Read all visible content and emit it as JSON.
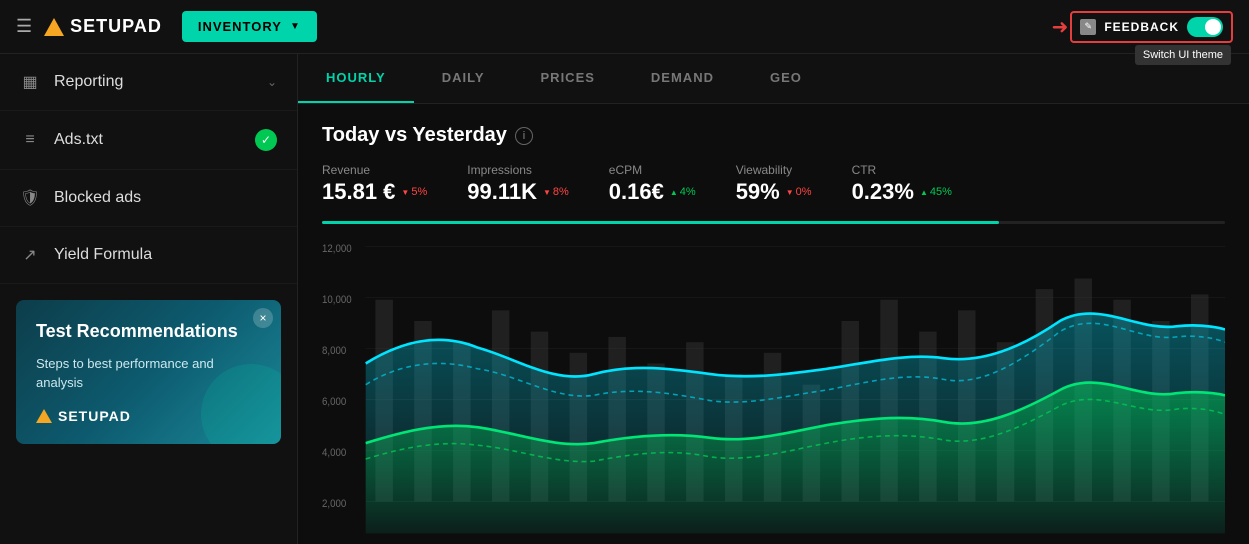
{
  "header": {
    "menu_label": "☰",
    "logo_text": "SETUPAD",
    "inventory_label": "INVENTORY",
    "feedback_label": "FEEDBACK",
    "switch_ui_tooltip": "Switch UI theme"
  },
  "sidebar": {
    "items": [
      {
        "id": "reporting",
        "label": "Reporting",
        "icon": "bar-chart",
        "has_chevron": true
      },
      {
        "id": "ads-txt",
        "label": "Ads.txt",
        "icon": "list",
        "has_check": true
      },
      {
        "id": "blocked-ads",
        "label": "Blocked ads",
        "icon": "shield",
        "has_nothing": true
      },
      {
        "id": "yield-formula",
        "label": "Yield Formula",
        "icon": "trending-up",
        "has_nothing": true
      }
    ],
    "promo": {
      "title": "Test Recommendations",
      "subtitle": "Steps to best performance and analysis",
      "logo_text": "SETUPAD",
      "close_label": "×"
    }
  },
  "tabs": [
    {
      "id": "hourly",
      "label": "HOURLY",
      "active": true
    },
    {
      "id": "daily",
      "label": "DAILY",
      "active": false
    },
    {
      "id": "prices",
      "label": "PRICES",
      "active": false
    },
    {
      "id": "demand",
      "label": "DEMAND",
      "active": false
    },
    {
      "id": "geo",
      "label": "GEO",
      "active": false
    }
  ],
  "chart": {
    "title": "Today vs Yesterday",
    "metrics": [
      {
        "label": "Revenue",
        "value": "15.81 €",
        "change": "5%",
        "direction": "down"
      },
      {
        "label": "Impressions",
        "value": "99.11K",
        "change": "8%",
        "direction": "down"
      },
      {
        "label": "eCPM",
        "value": "0.16€",
        "change": "4%",
        "direction": "up"
      },
      {
        "label": "Viewability",
        "value": "59%",
        "change": "0%",
        "direction": "down"
      },
      {
        "label": "CTR",
        "value": "0.23%",
        "change": "45%",
        "direction": "up"
      }
    ],
    "y_labels": [
      "12,000",
      "10,000",
      "8,000",
      "6,000",
      "4,000",
      "2,000"
    ],
    "progress_width": "75%"
  }
}
